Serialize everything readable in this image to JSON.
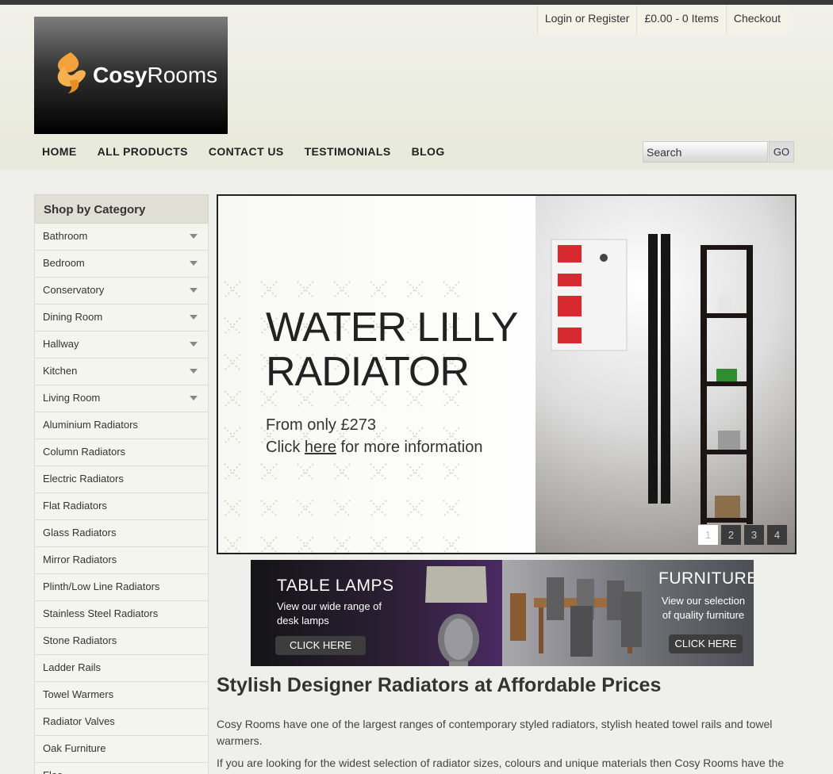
{
  "header": {
    "logo": {
      "brand_part1": "Cosy",
      "brand_part2": "Rooms"
    },
    "user_nav": {
      "login": "Login or Register",
      "cart": "£0.00 - 0 Items",
      "checkout": "Checkout"
    },
    "main_nav": [
      "HOME",
      "ALL PRODUCTS",
      "CONTACT US",
      "TESTIMONIALS",
      "BLOG"
    ],
    "search": {
      "placeholder": "Search",
      "button": "GO"
    }
  },
  "sidebar": {
    "title": "Shop by Category",
    "items": [
      {
        "label": "Bathroom",
        "expandable": true
      },
      {
        "label": "Bedroom",
        "expandable": true
      },
      {
        "label": "Conservatory",
        "expandable": true
      },
      {
        "label": "Dining Room",
        "expandable": true
      },
      {
        "label": "Hallway",
        "expandable": true
      },
      {
        "label": "Kitchen",
        "expandable": true
      },
      {
        "label": "Living Room",
        "expandable": true
      },
      {
        "label": "Aluminium Radiators",
        "expandable": false
      },
      {
        "label": "Column Radiators",
        "expandable": false
      },
      {
        "label": "Electric Radiators",
        "expandable": false
      },
      {
        "label": "Flat Radiators",
        "expandable": false
      },
      {
        "label": "Glass Radiators",
        "expandable": false
      },
      {
        "label": "Mirror Radiators",
        "expandable": false
      },
      {
        "label": "Plinth/Low Line Radiators",
        "expandable": false
      },
      {
        "label": "Stainless Steel Radiators",
        "expandable": false
      },
      {
        "label": "Stone Radiators",
        "expandable": false
      },
      {
        "label": "Ladder Rails",
        "expandable": false
      },
      {
        "label": "Towel Warmers",
        "expandable": false
      },
      {
        "label": "Radiator Valves",
        "expandable": false
      },
      {
        "label": "Oak Furniture",
        "expandable": false
      },
      {
        "label": "Floo",
        "expandable": false
      }
    ]
  },
  "slider": {
    "title_line1": "WATER LILLY",
    "title_line2": "RADIATOR",
    "price": "From only £273",
    "cta_prefix": "Click",
    "cta_link": "here",
    "cta_suffix": "for more information",
    "pages": [
      "1",
      "2",
      "3",
      "4"
    ],
    "active_page": 1
  },
  "promos": {
    "lamps": {
      "title": "TABLE LAMPS",
      "line1": "View our wide range of",
      "line2": "desk lamps",
      "button": "CLICK HERE"
    },
    "furniture": {
      "title": "FURNITURE",
      "line1": "View our selection",
      "line2": "of quality furniture",
      "button": "CLICK HERE"
    }
  },
  "content": {
    "heading": "Stylish Designer Radiators at Affordable Prices",
    "paragraphs": [
      "Cosy Rooms have one of the largest ranges of contemporary styled radiators, stylish heated towel rails and towel warmers.",
      "If you are looking for the widest selection of radiator sizes, colours and unique materials then Cosy Rooms have the"
    ]
  },
  "colors": {
    "accent_orange": "#f3a13a",
    "topbar": "#3a3a3a"
  }
}
